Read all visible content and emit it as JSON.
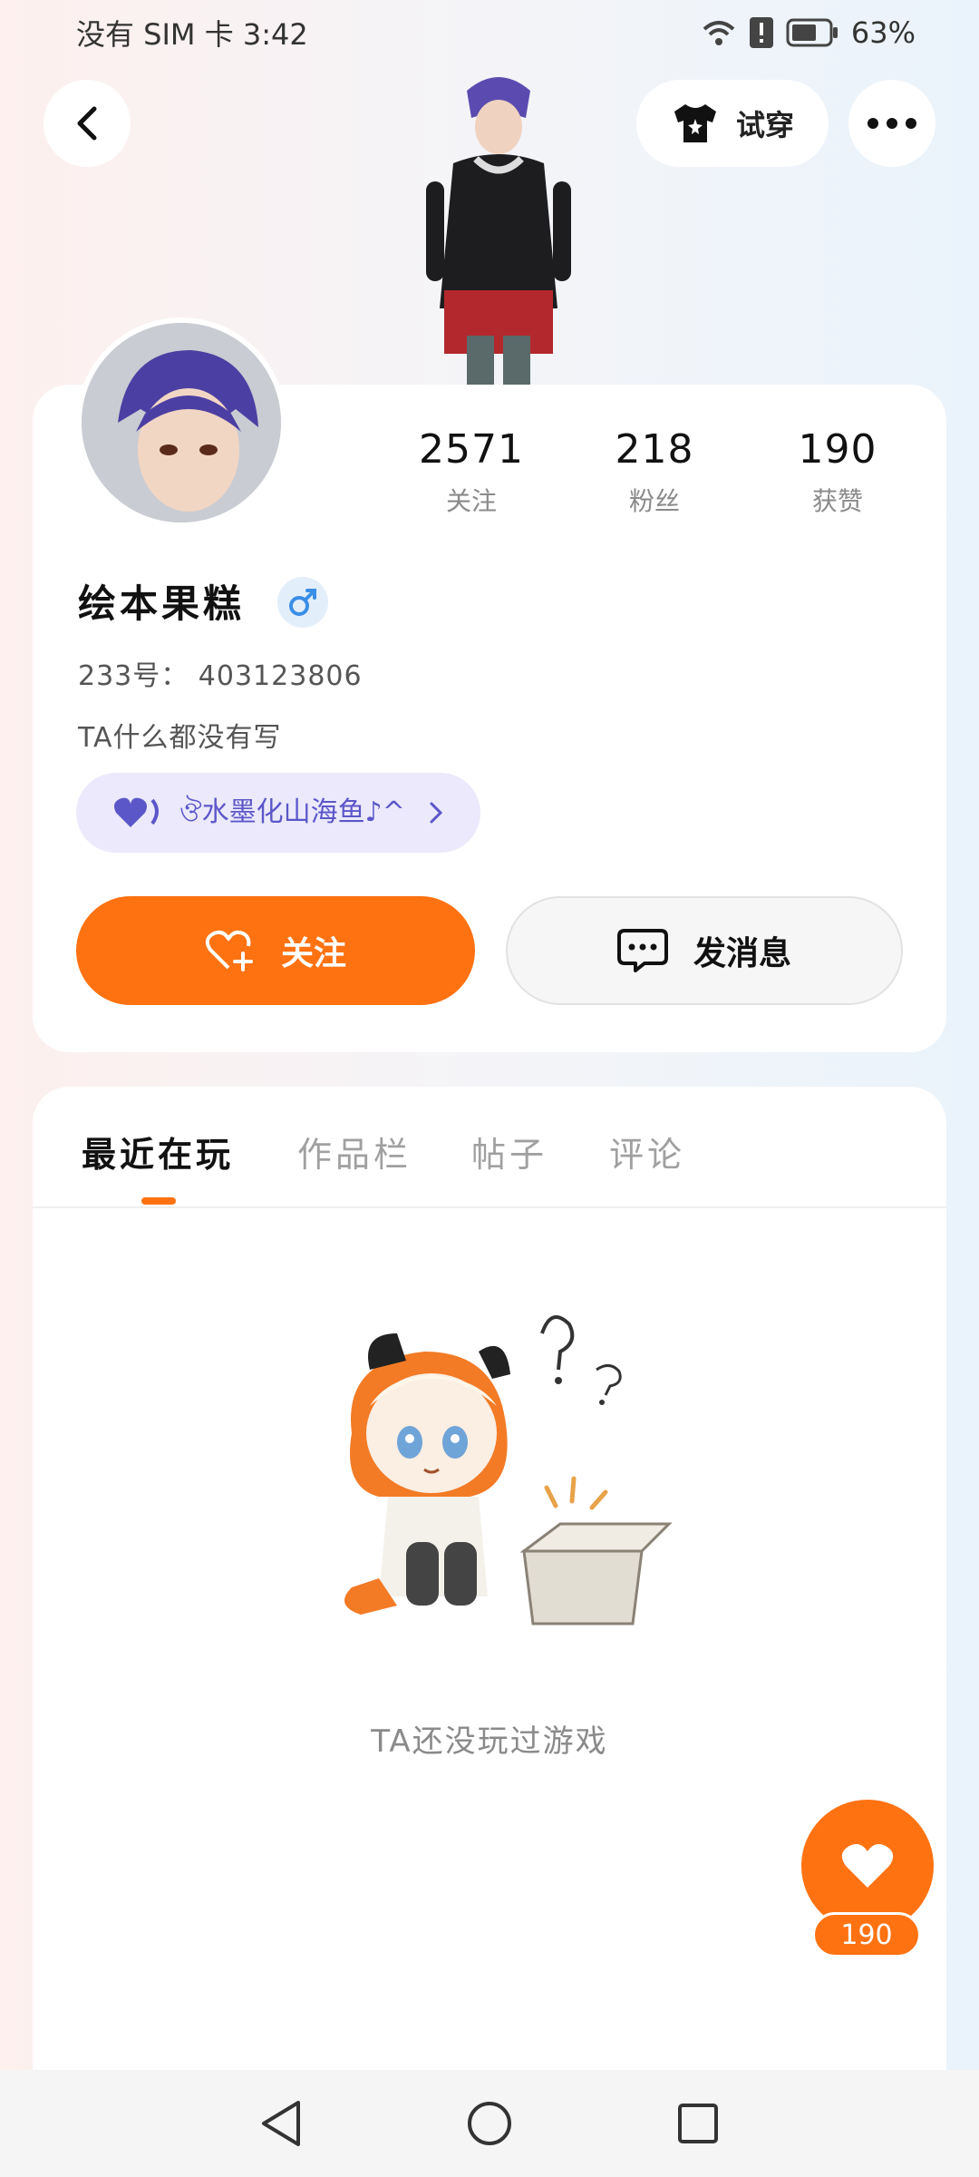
{
  "status_bar": {
    "carrier_time": "没有 SIM 卡 3:42",
    "battery": "63%",
    "icons": [
      "wifi-icon",
      "alert-icon",
      "battery-icon"
    ]
  },
  "header": {
    "tryon_label": "试穿",
    "icons": [
      "back-icon",
      "shirt-icon",
      "more-icon"
    ]
  },
  "profile": {
    "username": "绘本果糕",
    "gender": "male",
    "id_line": "233号： 403123806",
    "bio": "TA什么都没有写",
    "guild_label": "ঔ水墨化山海鱼♪^",
    "stats": [
      {
        "value": "2571",
        "label": "关注"
      },
      {
        "value": "218",
        "label": "粉丝"
      },
      {
        "value": "190",
        "label": "获赞"
      }
    ]
  },
  "actions": {
    "follow_label": "关注",
    "message_label": "发消息"
  },
  "tabs": [
    {
      "label": "最近在玩",
      "active": true
    },
    {
      "label": "作品栏",
      "active": false
    },
    {
      "label": "帖子",
      "active": false
    },
    {
      "label": "评论",
      "active": false
    }
  ],
  "empty_state": {
    "text": "TA还没玩过游戏"
  },
  "like_fab": {
    "count": "190"
  },
  "colors": {
    "accent": "#ff7212",
    "guild_bg": "#ebe9fb",
    "guild_text": "#5b57c9",
    "gender": "#3a8ee6"
  }
}
